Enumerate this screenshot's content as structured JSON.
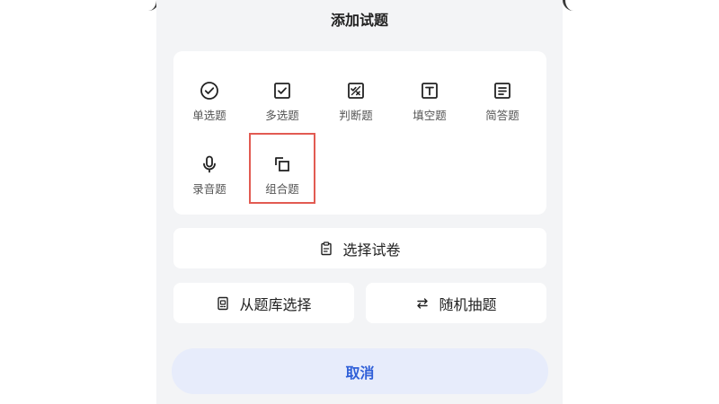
{
  "dialog": {
    "title": "添加试题"
  },
  "question_types": [
    {
      "label": "单选题",
      "icon": "check-circle-icon"
    },
    {
      "label": "多选题",
      "icon": "checkbox-icon"
    },
    {
      "label": "判断题",
      "icon": "true-false-icon"
    },
    {
      "label": "填空题",
      "icon": "text-t-icon"
    },
    {
      "label": "简答题",
      "icon": "text-lines-icon"
    },
    {
      "label": "录音题",
      "icon": "microphone-icon"
    },
    {
      "label": "组合题",
      "icon": "combine-icon"
    }
  ],
  "actions": {
    "select_paper": {
      "label": "选择试卷",
      "icon": "clipboard-icon"
    },
    "from_bank": {
      "label": "从题库选择",
      "icon": "question-bank-icon"
    },
    "random": {
      "label": "随机抽题",
      "icon": "swap-arrows-icon"
    }
  },
  "cancel": {
    "label": "取消"
  },
  "colors": {
    "accent": "#2f5fd8",
    "cancel_bg": "#e7ecfb",
    "sheet_bg": "#f3f4f6",
    "highlight": "#e25b52"
  }
}
